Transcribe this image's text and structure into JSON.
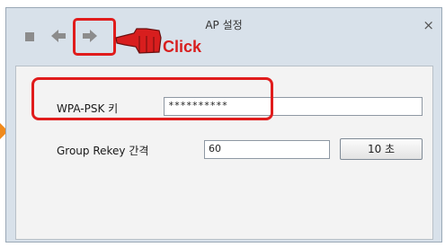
{
  "window": {
    "title": "AP 설정",
    "close_glyph": "×"
  },
  "toolbar": {
    "back_icon": "arrow-left-icon",
    "forward_icon": "arrow-right-icon",
    "menu_icon": "square-icon"
  },
  "annotation": {
    "click_label": "Click",
    "highlight_color": "#e01c1c",
    "pointer_color": "#f08a1c"
  },
  "form": {
    "psk": {
      "label": "WPA-PSK 키",
      "value": "**********"
    },
    "rekey": {
      "label": "Group Rekey 간격",
      "value": "60",
      "unit_button": "10 초"
    }
  }
}
